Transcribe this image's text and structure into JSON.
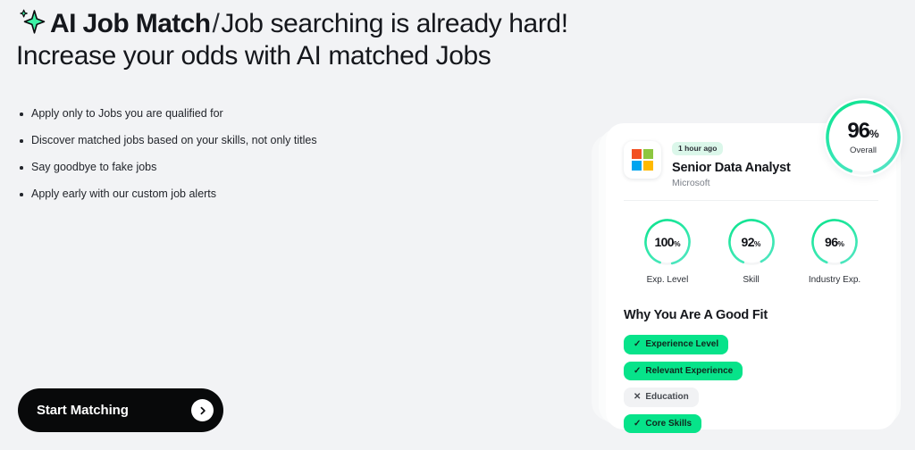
{
  "header": {
    "sparkle_icon": "sparkle-icon",
    "brand": "AI Job Match",
    "separator": "/",
    "tagline": "Job searching is already hard! Increase your odds with AI matched Jobs"
  },
  "bullets": [
    "Apply only to Jobs you are qualified for",
    "Discover matched jobs based on your skills, not only titles",
    "Say goodbye to fake jobs",
    "Apply early with our custom job alerts"
  ],
  "cta": {
    "label": "Start Matching",
    "icon": "chevron-right-icon"
  },
  "card": {
    "logo_icon": "microsoft-logo-icon",
    "time_badge": "1 hour ago",
    "job_title": "Senior Data Analyst",
    "company": "Microsoft",
    "overall": {
      "value": "96",
      "percent_symbol": "%",
      "caption": "Overall",
      "score": 96
    },
    "sub_scores": [
      {
        "value": "100",
        "percent_symbol": "%",
        "label": "Exp. Level",
        "score": 100
      },
      {
        "value": "92",
        "percent_symbol": "%",
        "label": "Skill",
        "score": 92
      },
      {
        "value": "96",
        "percent_symbol": "%",
        "label": "Industry Exp.",
        "score": 96
      }
    ],
    "fit_heading": "Why You Are A Good Fit",
    "fit_chips": [
      {
        "mark": "✓",
        "label": "Experience Level",
        "state": "positive"
      },
      {
        "mark": "✓",
        "label": "Relevant Experience",
        "state": "positive"
      },
      {
        "mark": "✕",
        "label": "Education",
        "state": "negative"
      },
      {
        "mark": "✓",
        "label": "Core Skills",
        "state": "positive"
      }
    ]
  },
  "colors": {
    "page_background": "#f2f3f5",
    "accent_green": "#07e38a",
    "accent_teal": "#4de3c0",
    "badge_green": "#dbf7ea",
    "chip_gray": "#f1f2f4",
    "cta_black": "#08090a",
    "ms_red": "#f25022",
    "ms_green": "#8cc63f",
    "ms_blue": "#00a4ef",
    "ms_yellow": "#ffb900"
  }
}
